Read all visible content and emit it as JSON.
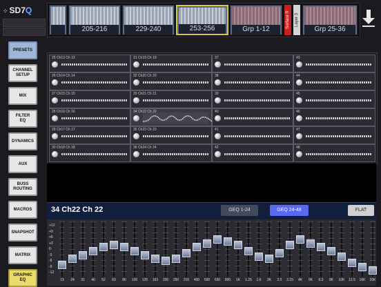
{
  "header": {
    "logo": {
      "prefix": "SD7",
      "suffix": "Q"
    },
    "banks": [
      {
        "label": "205-216"
      },
      {
        "label": "229-240"
      },
      {
        "label": "253-256",
        "selected": true
      },
      {
        "label": "Grp 1-12"
      },
      {
        "label": "Grp 25-36"
      }
    ],
    "surface_label": "Surface R",
    "layer_label": "Layer 3",
    "down_arrow_icon": "down-arrow-icon"
  },
  "menu": {
    "items": [
      {
        "label": "PRESETS",
        "state": "active"
      },
      {
        "label": "CHANNEL\nSETUP"
      },
      {
        "label": "MIX"
      },
      {
        "label": "FILTER\nEQ"
      },
      {
        "label": "DYNAMICS"
      },
      {
        "label": "AUX"
      },
      {
        "label": "BUSS\nROUTING"
      },
      {
        "label": "MACROS"
      },
      {
        "label": "SNAPSHOT"
      },
      {
        "label": "MATRIX"
      },
      {
        "label": "GRAPHIC\nEQ",
        "state": "highlight"
      }
    ]
  },
  "grid": {
    "columns": [
      [
        "25 Ch13 Ch 13",
        "26 Ch14 Ch 14",
        "27 Ch15 Ch 15",
        "28 Ch16 Ch 16",
        "29 Ch17 Ch 17",
        "30 Ch18 Ch 18"
      ],
      [
        "31 Ch19 Ch 19",
        "32 Ch20 Ch 20",
        "33 Ch21 Ch 21",
        "34 Ch22 Ch 22",
        "35 Ch23 Ch 23",
        "36 Ch24 Ch 24"
      ],
      [
        "37",
        "38",
        "39",
        "40",
        "41",
        "42"
      ],
      [
        "43",
        "44",
        "45",
        "46",
        "47",
        "48"
      ]
    ],
    "selected": {
      "column": 1,
      "row": 3
    }
  },
  "bottom": {
    "channel_title": "34 Ch22 Ch 22",
    "geq_1_24": "GEQ 1-24",
    "geq_24_48": "GEQ 24-48",
    "flat": "FLAT"
  },
  "geq": {
    "scale": [
      "+12",
      "+9",
      "+6",
      "+3",
      "0",
      "-3",
      "-6",
      "-9",
      "-12"
    ],
    "bands": [
      {
        "freq": "19",
        "gain": -8
      },
      {
        "freq": "24",
        "gain": -5
      },
      {
        "freq": "31",
        "gain": -3
      },
      {
        "freq": "40",
        "gain": -1
      },
      {
        "freq": "52",
        "gain": 1
      },
      {
        "freq": "63",
        "gain": 2
      },
      {
        "freq": "80",
        "gain": 1
      },
      {
        "freq": "100",
        "gain": -1
      },
      {
        "freq": "125",
        "gain": -3
      },
      {
        "freq": "163",
        "gain": -5
      },
      {
        "freq": "200",
        "gain": -6
      },
      {
        "freq": "250",
        "gain": -5
      },
      {
        "freq": "315",
        "gain": -2
      },
      {
        "freq": "400",
        "gain": 1
      },
      {
        "freq": "500",
        "gain": 3
      },
      {
        "freq": "630",
        "gain": 5
      },
      {
        "freq": "800",
        "gain": 4
      },
      {
        "freq": "1K",
        "gain": 2
      },
      {
        "freq": "1.25",
        "gain": -1
      },
      {
        "freq": "1.6",
        "gain": -4
      },
      {
        "freq": "2K",
        "gain": -5
      },
      {
        "freq": "2.5",
        "gain": -2
      },
      {
        "freq": "3.15",
        "gain": 2
      },
      {
        "freq": "4K",
        "gain": 5
      },
      {
        "freq": "5K",
        "gain": 3
      },
      {
        "freq": "6.3",
        "gain": 1
      },
      {
        "freq": "8K",
        "gain": -1
      },
      {
        "freq": "10K",
        "gain": -4
      },
      {
        "freq": "12.5",
        "gain": -7
      },
      {
        "freq": "16K",
        "gain": -9
      },
      {
        "freq": "20K",
        "gain": -11
      }
    ]
  },
  "colors": {
    "accent": "#5a68f0",
    "selected_bank": "#d8c84a",
    "surface": "#c82020"
  }
}
